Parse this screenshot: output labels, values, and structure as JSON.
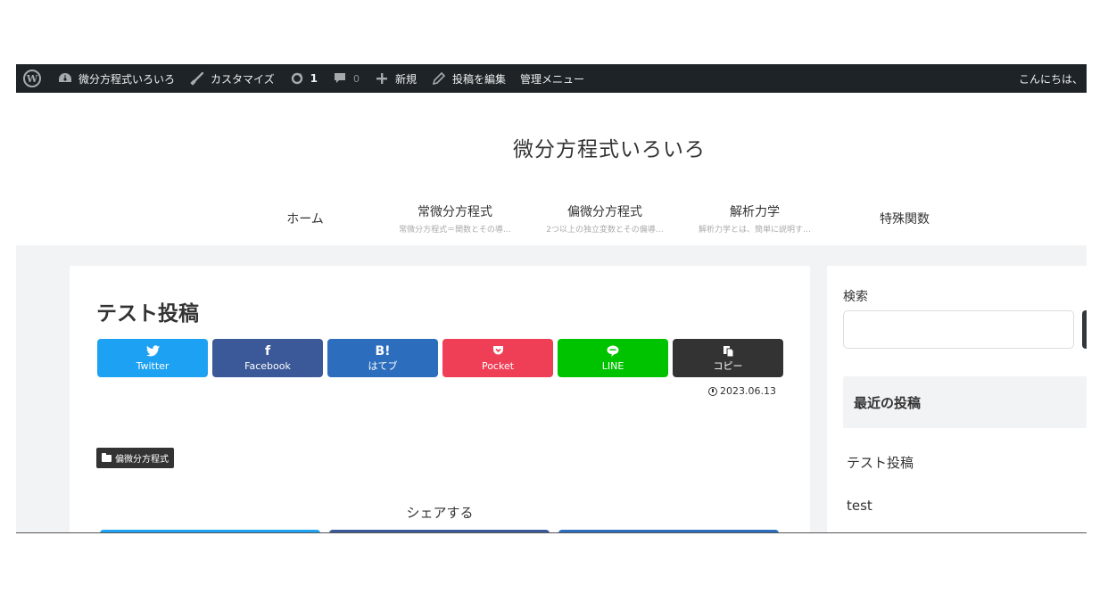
{
  "admin_bar": {
    "wp_logo": "W",
    "site_name": "微分方程式いろいろ",
    "customize": "カスタマイズ",
    "updates_count": "1",
    "comments_count": "0",
    "new": "新規",
    "edit_post": "投稿を編集",
    "admin_menu": "管理メニュー",
    "greeting": "こんにちは、"
  },
  "site": {
    "title": "微分方程式いろいろ"
  },
  "global_nav": [
    {
      "label": "ホーム",
      "sub": ""
    },
    {
      "label": "常微分方程式",
      "sub": "常微分方程式＝関数とその導…"
    },
    {
      "label": "偏微分方程式",
      "sub": "2つ以上の独立変数とその偏導…"
    },
    {
      "label": "解析力学",
      "sub": "解析力学とは、簡単に説明す…"
    },
    {
      "label": "特殊関数",
      "sub": ""
    }
  ],
  "post": {
    "title": "テスト投稿",
    "date": "2023.06.13",
    "category": "偏微分方程式",
    "share_heading": "シェアする"
  },
  "share_buttons": [
    {
      "name": "twitter",
      "icon": "twitter-bird",
      "glyph": "🐦",
      "label": "Twitter",
      "color": "#1da1f2"
    },
    {
      "name": "facebook",
      "icon": "facebook-f",
      "glyph": "f",
      "label": "Facebook",
      "color": "#3b5998"
    },
    {
      "name": "hatena",
      "icon": "hatena-b",
      "glyph": "B!",
      "label": "はてブ",
      "color": "#2c6ebd"
    },
    {
      "name": "pocket",
      "icon": "pocket",
      "glyph": "⌄",
      "label": "Pocket",
      "color": "#ef3f56"
    },
    {
      "name": "line",
      "icon": "line-bubble",
      "glyph": "●",
      "label": "LINE",
      "color": "#00c300"
    },
    {
      "name": "copy",
      "icon": "copy-doc",
      "glyph": "❐",
      "label": "コピー",
      "color": "#333333"
    }
  ],
  "share_buttons_bottom": [
    {
      "name": "twitter",
      "color": "#1da1f2"
    },
    {
      "name": "facebook",
      "color": "#3b5998"
    },
    {
      "name": "hatena",
      "color": "#2c6ebd"
    }
  ],
  "sidebar": {
    "search_label": "検索",
    "search_value": "",
    "recent_heading": "最近の投稿",
    "recent_posts": [
      "テスト投稿",
      "test"
    ]
  }
}
